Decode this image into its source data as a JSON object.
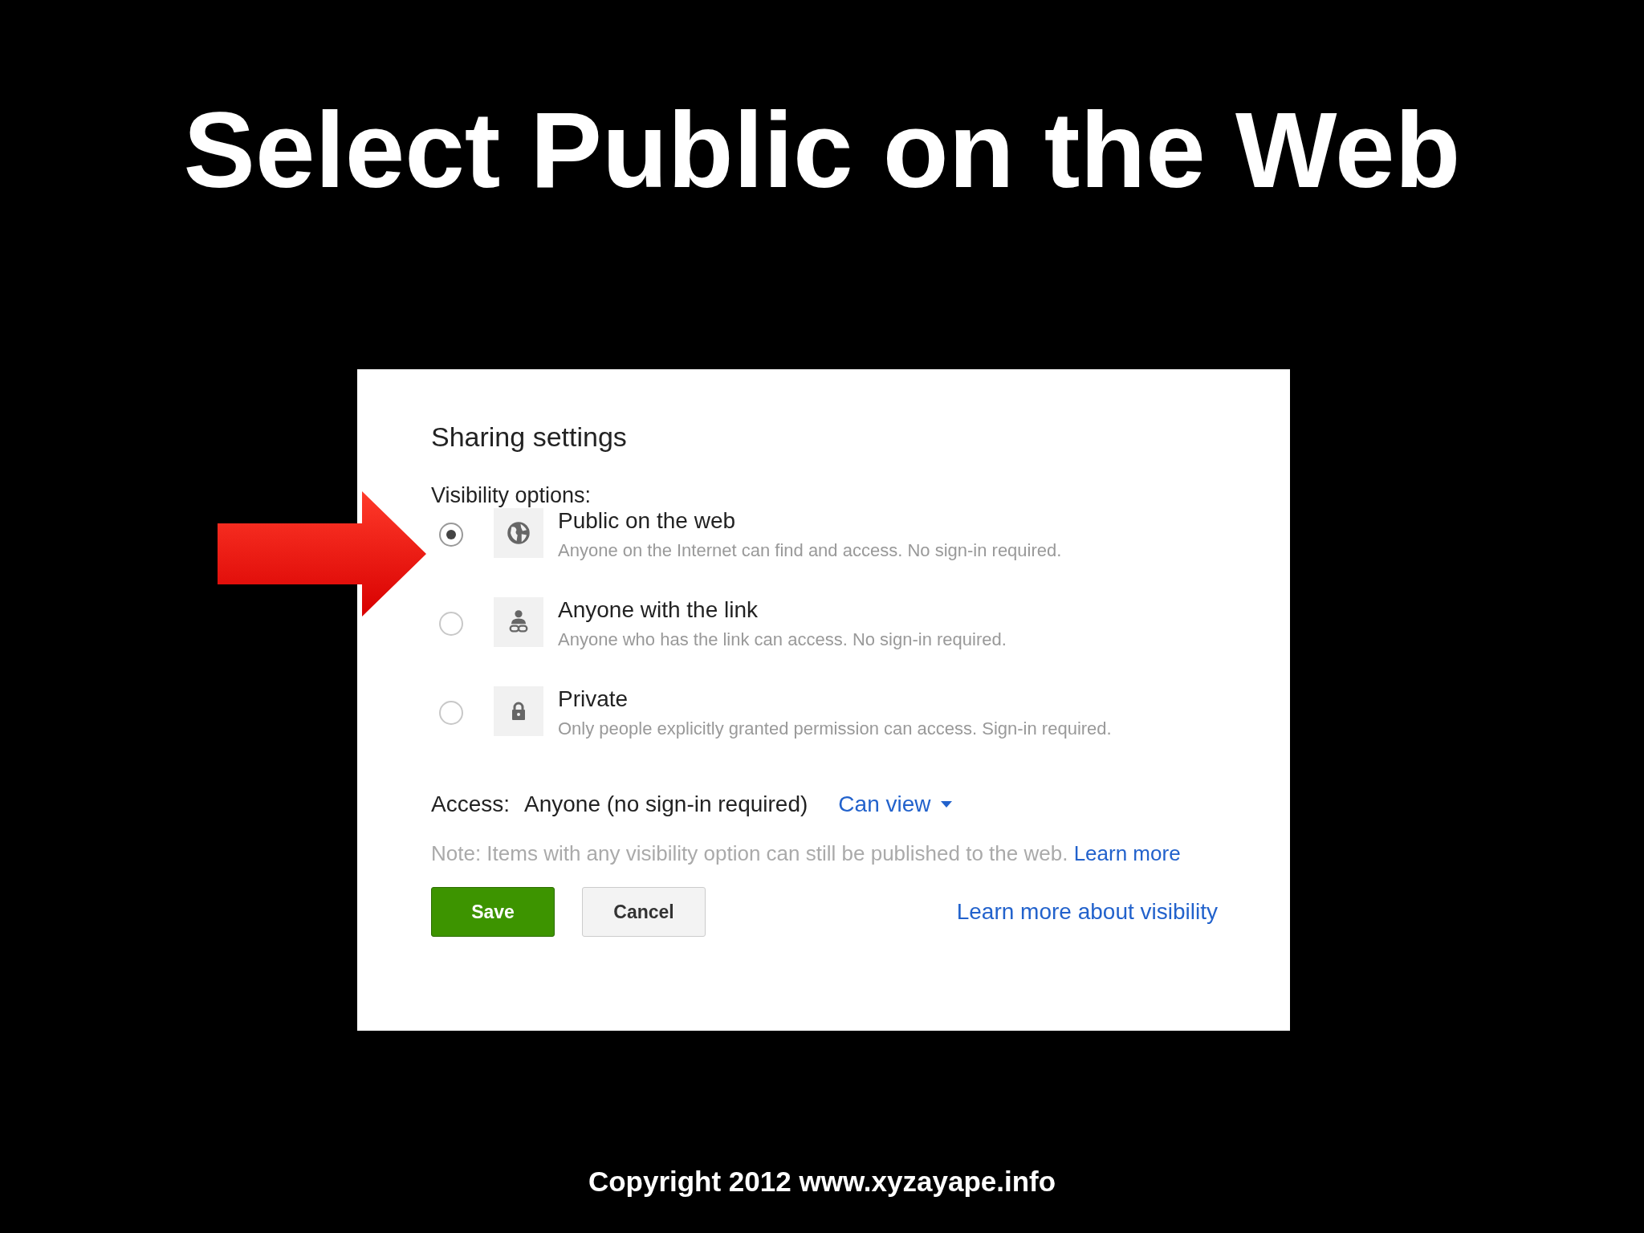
{
  "slide_title": "Select Public on the Web",
  "dialog": {
    "title": "Sharing settings",
    "section_label": "Visibility options:",
    "options": [
      {
        "kind": "globe",
        "label": "Public on the web",
        "description": "Anyone on the Internet can find and access. No sign-in required.",
        "selected": true
      },
      {
        "kind": "link",
        "label": "Anyone with the link",
        "description": "Anyone who has the link can access. No sign-in required.",
        "selected": false
      },
      {
        "kind": "lock",
        "label": "Private",
        "description": "Only people explicitly granted permission can access. Sign-in required.",
        "selected": false
      }
    ],
    "access_label": "Access:",
    "access_value": "Anyone (no sign-in required)",
    "permission": "Can view",
    "note": "Note: Items with any visibility option can still be published to the web.",
    "note_link": "Learn more",
    "buttons": [
      "Save",
      "Cancel"
    ],
    "help_link": "Learn more about visibility"
  },
  "footer": "Copyright 2012 www.xyzayape.info"
}
